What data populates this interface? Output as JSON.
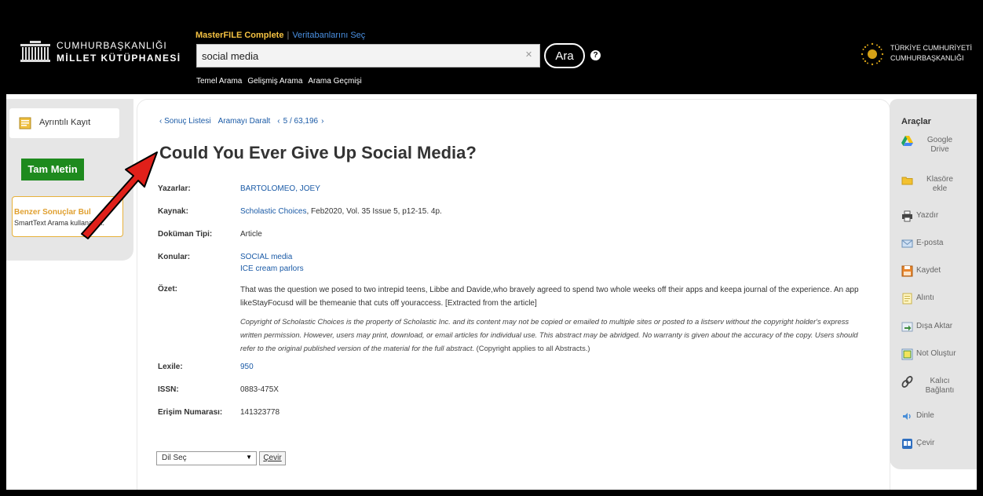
{
  "header": {
    "logo_line1": "CUMHURBAŞKANLIĞI",
    "logo_line2": "MİLLET KÜTÜPHANESİ",
    "database_name": "MasterFILE Complete",
    "database_separator": "|",
    "choose_databases": "Veritabanlarını Seç",
    "search_value": "social media",
    "search_button": "Ara",
    "help_icon": "?",
    "tabs": [
      "Temel Arama",
      "Gelişmiş Arama",
      "Arama Geçmişi"
    ],
    "presidency_line1": "TÜRKİYE CUMHURİYETİ",
    "presidency_line2": "CUMHURBAŞKANLIĞI"
  },
  "left": {
    "detail_tab": "Ayrıntılı Kayıt",
    "full_text": "Tam Metin",
    "similar_title": "Benzer Sonuçlar Bul",
    "similar_sub": "SmartText Arama kullanarak."
  },
  "nav": {
    "result_list": "‹ Sonuç Listesi",
    "refine": "Aramayı Daralt",
    "prev": "‹",
    "position": "5 / 63,196",
    "next": "›"
  },
  "article": {
    "title": "Could You Ever Give Up Social Media?",
    "fields": {
      "authors_label": "Yazarlar:",
      "authors_value": "BARTOLOMEO, JOEY",
      "source_label": "Kaynak:",
      "source_link": "Scholastic Choices",
      "source_rest": ", Feb2020, Vol. 35 Issue 5, p12-15. 4p.",
      "doctype_label": "Doküman Tipi:",
      "doctype_value": "Article",
      "subjects_label": "Konular:",
      "subjects": [
        "SOCIAL media",
        "ICE cream parlors"
      ],
      "abstract_label": "Özet:",
      "abstract": "That was the question we posed to two intrepid teens, Libbe and Davide,who bravely agreed to spend two whole weeks off their apps and keepa journal of the experience. An app likeStayFocusd will be themeanie that cuts off youraccess. [Extracted from the article]",
      "copyright_italic": "Copyright of Scholastic Choices is the property of Scholastic Inc. and its content may not be copied or emailed to multiple sites or posted to a listserv without the copyright holder's express written permission. However, users may print, download, or email articles for individual use. This abstract may be abridged. No warranty is given about the accuracy of the copy. Users should refer to the original published version of the material for the full abstract.",
      "copyright_note": " (Copyright applies to all Abstracts.)",
      "lexile_label": "Lexile:",
      "lexile_value": "950",
      "issn_label": "ISSN:",
      "issn_value": "0883-475X",
      "accession_label": "Erişim Numarası:",
      "accession_value": "141323778"
    },
    "language_select": "Dil Seç",
    "translate_button": "Çevir"
  },
  "tools": {
    "title": "Araçlar",
    "items": [
      {
        "label1": "Google",
        "label2": "Drive",
        "icon": "google-drive-icon"
      },
      {
        "label1": "Klasöre",
        "label2": "ekle",
        "icon": "folder-icon"
      },
      {
        "label1": "Yazdır",
        "label2": "",
        "icon": "printer-icon"
      },
      {
        "label1": "E-posta",
        "label2": "",
        "icon": "email-icon"
      },
      {
        "label1": "Kaydet",
        "label2": "",
        "icon": "save-icon"
      },
      {
        "label1": "Alıntı",
        "label2": "",
        "icon": "cite-icon"
      },
      {
        "label1": "Dışa Aktar",
        "label2": "",
        "icon": "export-icon"
      },
      {
        "label1": "Not Oluştur",
        "label2": "",
        "icon": "note-icon"
      },
      {
        "label1": "Kalıcı",
        "label2": "Bağlantı",
        "icon": "permalink-icon"
      },
      {
        "label1": "Dinle",
        "label2": "",
        "icon": "listen-icon"
      },
      {
        "label1": "Çevir",
        "label2": "",
        "icon": "translate-icon"
      }
    ]
  },
  "colors": {
    "accent_link": "#1a5aa6",
    "full_text_green": "#1e8a1e",
    "database_gold": "#f5c242",
    "arrow_red": "#e0201a"
  }
}
